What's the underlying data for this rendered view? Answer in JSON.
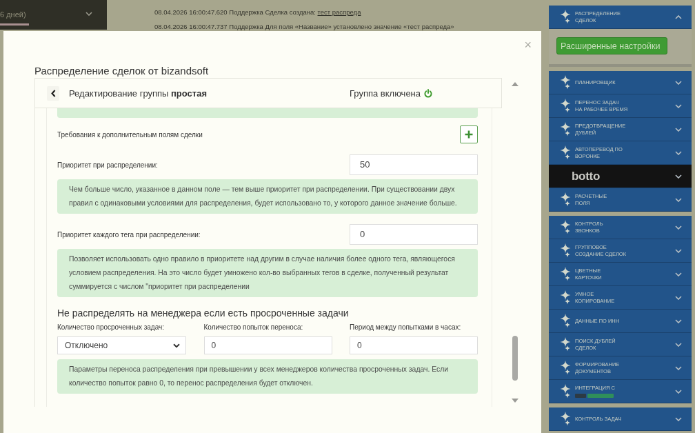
{
  "background": {
    "period_filter": {
      "label": "6 дней)"
    },
    "log": [
      {
        "time": "08.04.2026 16:00:47.620",
        "author": "Поддержка",
        "text": "Сделка создана:",
        "link": "тест распреда"
      },
      {
        "time": "08.04.2026 16:00:47.737",
        "author": "Поддержка",
        "text": "Для поля «Название» установлено значение «тест распреда»"
      }
    ]
  },
  "modal": {
    "title": "Распределение сделок от bizandsoft",
    "close": "×",
    "header": {
      "title": "Редактирование группы **простая**",
      "status": "Группа включена",
      "enabled": true
    },
    "content": [
      {
        "kind": "note_end"
      },
      {
        "kind": "add",
        "label": "Требования к дополнительным полям сделки"
      },
      {
        "kind": "number",
        "label": "Приоритет при распределении:",
        "value": "50"
      },
      {
        "kind": "note",
        "text": "Чем больше число, указанное в данном поле — тем выше приоритет при распределении. При существовании двух правил с одинаковыми условиями для распределения, будет использовано то, у которого данное значение больше."
      },
      {
        "kind": "number",
        "label": "Приоритет каждого тега при распределении:",
        "value": "0"
      },
      {
        "kind": "note",
        "text": "Позволяет использовать одно правило в приоритете над другим в случае наличия более одного тега, являющегося условием распределения. На это число будет умножено кол-во выбранных тегов в сделке, полученный результат суммируется с числом \"приоритет при распределении"
      },
      {
        "kind": "heading",
        "text": "Не распределять на менеджера если есть просроченные задачи"
      },
      {
        "kind": "fields",
        "fields": [
          {
            "kind": "select",
            "label": "Количество просроченных задач:",
            "value": "Отключено"
          },
          {
            "kind": "input",
            "label": "Количество попыток переноса:",
            "value": "0"
          },
          {
            "kind": "input",
            "label": "Период между попытками в часах:",
            "value": "0"
          }
        ]
      },
      {
        "kind": "note",
        "text": "Параметры переноса распределения при превышении у всех менеджеров количества просроченных задач. Если количество попыток равно 0, то перенос распределения будет отключен."
      }
    ]
  },
  "sidebar": {
    "groups": [
      {
        "items": [
          {
            "kind": "module",
            "label": "РАСПРЕДЕЛЕНИЕ\nСДЕЛОК",
            "expanded": true,
            "action": "Расширенные настройки"
          }
        ]
      },
      {
        "items": [
          {
            "kind": "module",
            "label": "ПЛАНИРОВЩИК",
            "expanded": false
          },
          {
            "kind": "module",
            "label": "ПЕРЕНОС ЗАДАЧ\nНА РАБОЧЕЕ ВРЕМЯ",
            "expanded": false
          },
          {
            "kind": "module",
            "label": "ПРЕДОТВРАЩЕНИЕ\nДУБЛЕЙ",
            "expanded": false
          },
          {
            "kind": "module",
            "label": "АВТОПЕРЕВОД ПО\nВОРОНКЕ",
            "expanded": false
          },
          {
            "kind": "logo",
            "label": "botto",
            "expanded": false
          },
          {
            "kind": "module",
            "label": "РАСЧЕТНЫЕ\nПОЛЯ",
            "expanded": false
          }
        ]
      },
      {
        "items": [
          {
            "kind": "module",
            "label": "КОНТРОЛЬ\nЗВОНКОВ",
            "expanded": false
          },
          {
            "kind": "module",
            "label": "ГРУППОВОЕ\nСОЗДАНИЕ СДЕЛОК",
            "expanded": false
          },
          {
            "kind": "module",
            "label": "ЦВЕТНЫЕ\nКАРТОЧКИ",
            "expanded": false
          },
          {
            "kind": "module",
            "label": "УМНОЕ\nКОПИРОВАНИЕ",
            "expanded": false
          },
          {
            "kind": "module",
            "label": "ДАННЫЕ ПО ИНН",
            "expanded": false
          },
          {
            "kind": "module",
            "label": "ПОИСК ДУБЛЕЙ\nСДЕЛОК",
            "expanded": false
          },
          {
            "kind": "module",
            "label": "ФОРМИРОВАНИЕ\nДОКУМЕНТОВ",
            "expanded": false
          },
          {
            "kind": "partner",
            "label": "ИНТЕГРАЦИЯ С",
            "expanded": false
          }
        ]
      },
      {
        "items": [
          {
            "kind": "module",
            "label": "КОНТРОЛЬ ЗАДАЧ",
            "expanded": false
          }
        ]
      }
    ]
  }
}
